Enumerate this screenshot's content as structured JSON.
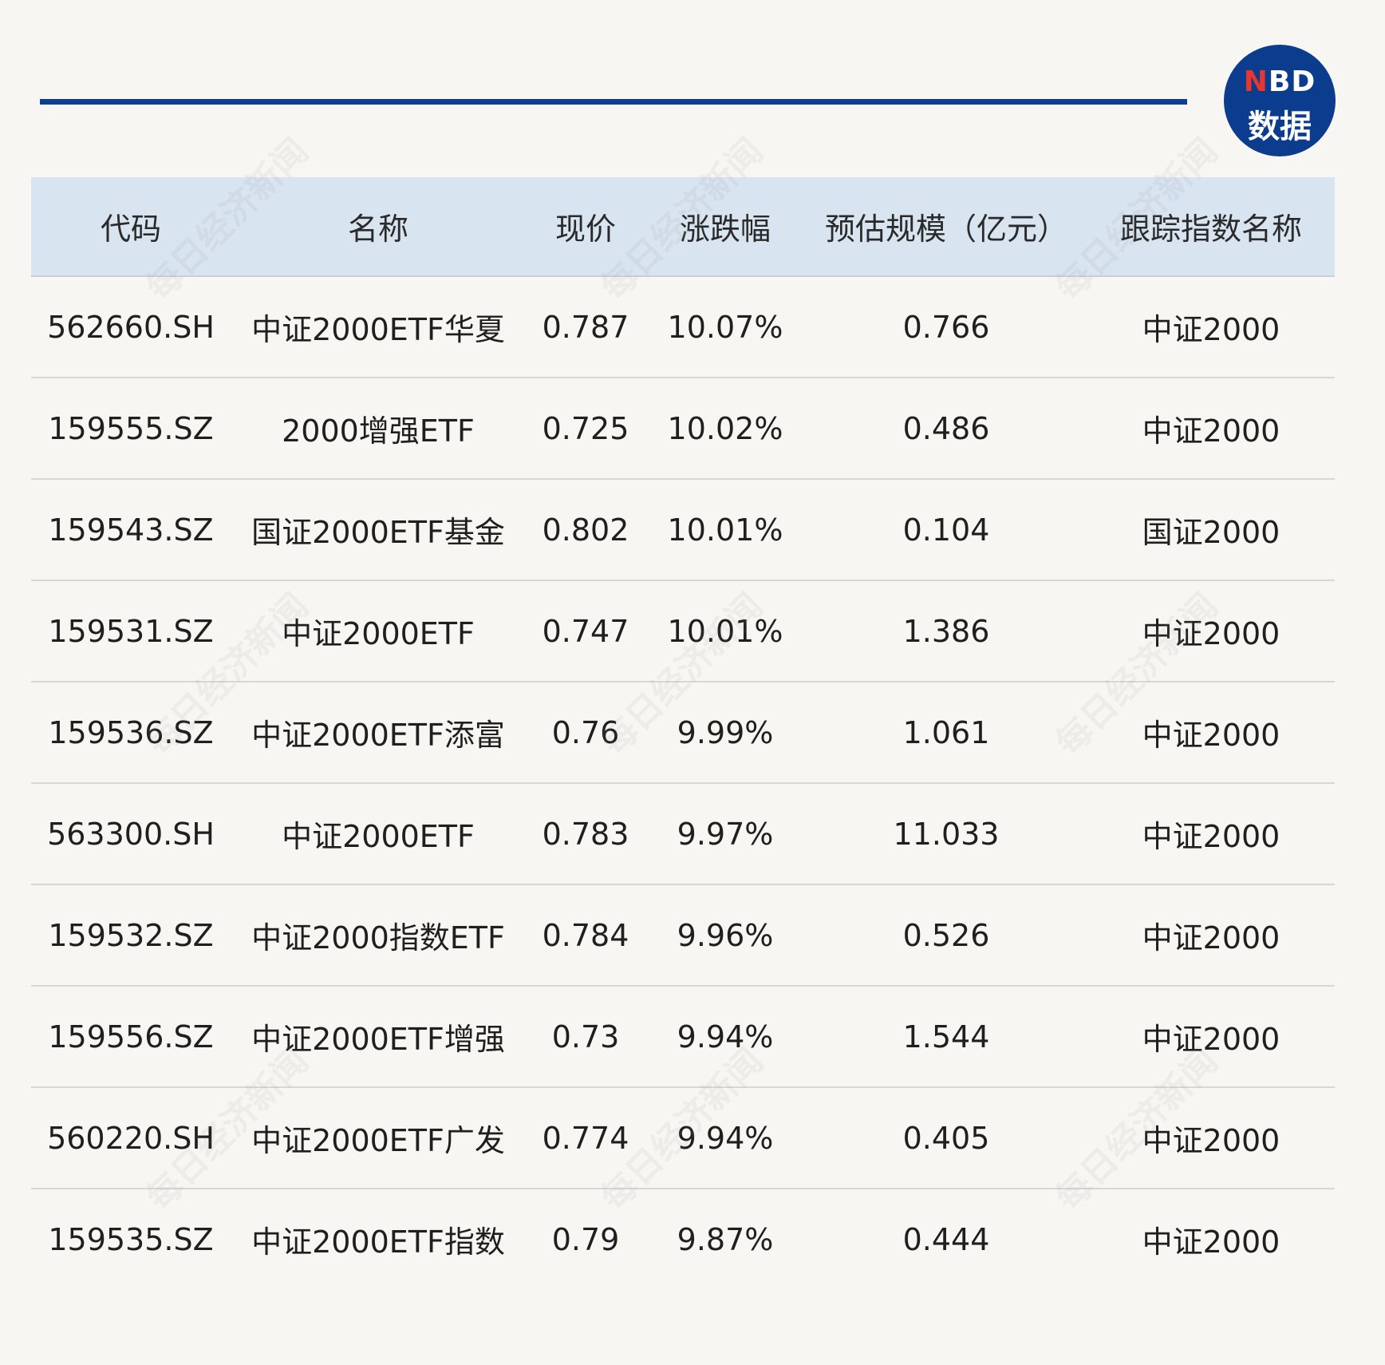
{
  "logo": {
    "n": "N",
    "bd": "BD",
    "line2": "数据"
  },
  "watermark_text": "每日经济新闻",
  "chart_data": {
    "type": "table",
    "columns": [
      "代码",
      "名称",
      "现价",
      "涨跌幅",
      "预估规模（亿元）",
      "跟踪指数名称"
    ],
    "rows": [
      [
        "562660.SH",
        "中证2000ETF华夏",
        "0.787",
        "10.07%",
        "0.766",
        "中证2000"
      ],
      [
        "159555.SZ",
        "2000增强ETF",
        "0.725",
        "10.02%",
        "0.486",
        "中证2000"
      ],
      [
        "159543.SZ",
        "国证2000ETF基金",
        "0.802",
        "10.01%",
        "0.104",
        "国证2000"
      ],
      [
        "159531.SZ",
        "中证2000ETF",
        "0.747",
        "10.01%",
        "1.386",
        "中证2000"
      ],
      [
        "159536.SZ",
        "中证2000ETF添富",
        "0.76",
        "9.99%",
        "1.061",
        "中证2000"
      ],
      [
        "563300.SH",
        "中证2000ETF",
        "0.783",
        "9.97%",
        "11.033",
        "中证2000"
      ],
      [
        "159532.SZ",
        "中证2000指数ETF",
        "0.784",
        "9.96%",
        "0.526",
        "中证2000"
      ],
      [
        "159556.SZ",
        "中证2000ETF增强",
        "0.73",
        "9.94%",
        "1.544",
        "中证2000"
      ],
      [
        "560220.SH",
        "中证2000ETF广发",
        "0.774",
        "9.94%",
        "0.405",
        "中证2000"
      ],
      [
        "159535.SZ",
        "中证2000ETF指数",
        "0.79",
        "9.87%",
        "0.444",
        "中证2000"
      ]
    ]
  },
  "colors": {
    "accent": "#0b3f91",
    "header_bg": "#d8e4f0",
    "background": "#f8f6f2"
  }
}
